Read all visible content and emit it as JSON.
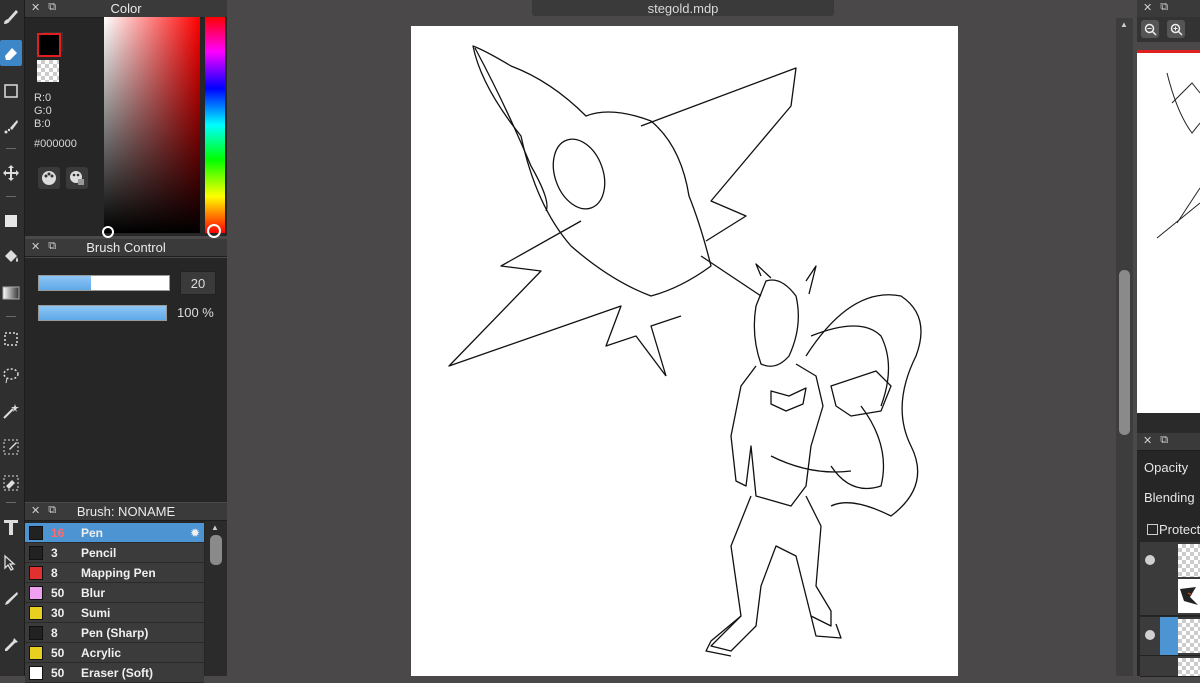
{
  "document": {
    "title": "stegold.mdp"
  },
  "toolbar": {
    "tools": [
      {
        "name": "brush-tool",
        "icon": "brush-icon"
      },
      {
        "name": "eraser-tool",
        "icon": "eraser-icon",
        "active": true
      },
      {
        "name": "rectangle-tool",
        "icon": "rectangle-icon"
      },
      {
        "name": "dot-brush-tool",
        "icon": "dotted-brush-icon"
      },
      {
        "name": "move-tool",
        "icon": "move-arrows-icon"
      },
      {
        "name": "fill-rect-tool",
        "icon": "filled-square-icon"
      },
      {
        "name": "bucket-tool",
        "icon": "paint-bucket-icon"
      },
      {
        "name": "gradient-tool",
        "icon": "gradient-icon"
      },
      {
        "name": "select-rect-tool",
        "icon": "selection-rect-icon"
      },
      {
        "name": "lasso-tool",
        "icon": "lasso-icon"
      },
      {
        "name": "magic-wand-tool",
        "icon": "magic-wand-icon"
      },
      {
        "name": "select-pen-tool",
        "icon": "select-pen-icon"
      },
      {
        "name": "select-eraser-tool",
        "icon": "select-eraser-icon"
      },
      {
        "name": "text-tool",
        "icon": "text-icon"
      },
      {
        "name": "operation-tool",
        "icon": "pointer-icon"
      },
      {
        "name": "eyedropper-tool",
        "icon": "pen-nib-icon"
      },
      {
        "name": "dropper-tool",
        "icon": "eyedropper-icon"
      }
    ]
  },
  "color_panel": {
    "title": "Color",
    "r": "R:0",
    "g": "G:0",
    "b": "B:0",
    "hex": "#000000",
    "foreground": "#000000",
    "background": "#333333"
  },
  "brush_control": {
    "title": "Brush Control",
    "size": "20",
    "size_fraction": 0.4,
    "opacity": "100 %",
    "opacity_fraction": 1.0
  },
  "brush_list": {
    "title": "Brush: NONAME",
    "items": [
      {
        "size": "16",
        "name": "Pen",
        "color": "#222222",
        "selected": true
      },
      {
        "size": "3",
        "name": "Pencil",
        "color": "#222222"
      },
      {
        "size": "8",
        "name": "Mapping Pen",
        "color": "#e03030"
      },
      {
        "size": "50",
        "name": "Blur",
        "color": "#f0a0f0"
      },
      {
        "size": "30",
        "name": "Sumi",
        "color": "#e8d020"
      },
      {
        "size": "8",
        "name": "Pen (Sharp)",
        "color": "#222222"
      },
      {
        "size": "50",
        "name": "Acrylic",
        "color": "#e8d020"
      },
      {
        "size": "50",
        "name": "Eraser (Soft)",
        "color": "#ffffff"
      }
    ]
  },
  "layer_panel": {
    "opacity_label": "Opacity",
    "blending_label": "Blending",
    "protect_label": "Protect"
  },
  "colors": {
    "accent": "#3d86c8",
    "nav_frame": "#e02020"
  }
}
